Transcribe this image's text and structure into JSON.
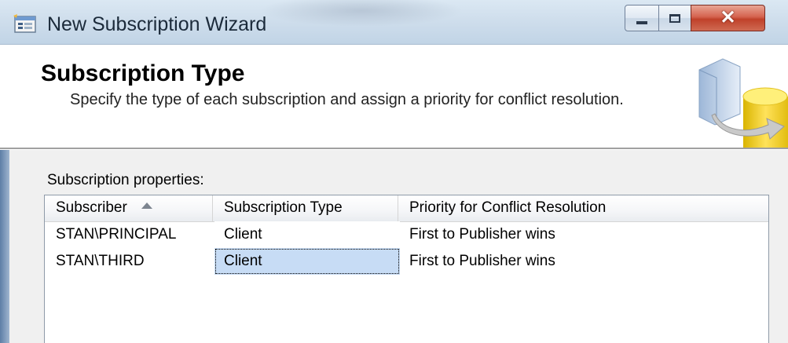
{
  "window": {
    "title": "New Subscription Wizard"
  },
  "header": {
    "title": "Subscription Type",
    "description": "Specify the type of each subscription and assign a priority for conflict resolution."
  },
  "properties": {
    "label": "Subscription properties:",
    "columns": [
      "Subscriber",
      "Subscription Type",
      "Priority for Conflict Resolution"
    ],
    "sorted_column": "Subscriber",
    "sort_direction": "ascending",
    "rows": [
      {
        "subscriber": "STAN\\PRINCIPAL",
        "type": "Client",
        "priority": "First to Publisher wins"
      },
      {
        "subscriber": "STAN\\THIRD",
        "type": "Client",
        "priority": "First to Publisher wins"
      }
    ],
    "selected_row": 2
  },
  "colors": {
    "selection": "#c7dcf5",
    "close_button": "#c0412a"
  },
  "icons": {
    "app": "wizard-window-icon",
    "minimize": "minimize-icon",
    "maximize": "maximize-icon",
    "close": "close-icon",
    "sort": "sort-ascending-icon",
    "header_art": "database-sync-icon"
  }
}
